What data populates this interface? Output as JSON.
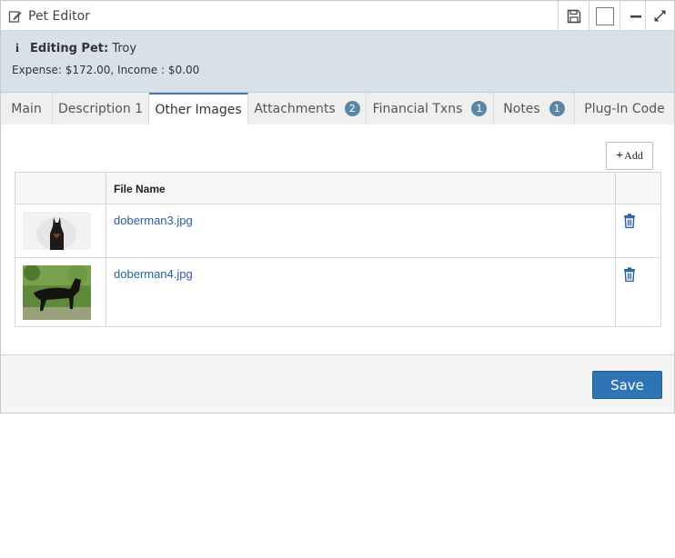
{
  "window": {
    "title": "Pet Editor"
  },
  "info": {
    "editing_label": "Editing Pet:",
    "pet_name": "Troy",
    "summary": "Expense: $172.00, Income : $0.00"
  },
  "tabs": [
    {
      "label": "Main",
      "badge": null,
      "active": false
    },
    {
      "label": "Description 1",
      "badge": null,
      "active": false
    },
    {
      "label": "Other Images",
      "badge": null,
      "active": true
    },
    {
      "label": "Attachments",
      "badge": "2",
      "active": false
    },
    {
      "label": "Financial Txns",
      "badge": "1",
      "active": false
    },
    {
      "label": "Notes",
      "badge": "1",
      "active": false
    },
    {
      "label": "Plug-In Code",
      "badge": null,
      "active": false
    }
  ],
  "toolbar": {
    "add_label": "Add"
  },
  "grid": {
    "columns": [
      "",
      "File Name",
      ""
    ],
    "rows": [
      {
        "file_name": "doberman3.jpg"
      },
      {
        "file_name": "doberman4.jpg"
      }
    ]
  },
  "footer": {
    "save_label": "Save"
  },
  "colors": {
    "accent": "#2f74b5",
    "badge": "#5a87a8",
    "info_bg": "#d8e0ea",
    "link": "#2a5f9e"
  },
  "icons": {
    "title": "edit-icon",
    "info": "info-icon",
    "delete": "trash-icon",
    "save_window": "floppy-disk-icon",
    "minimize": "minimize-icon",
    "expand": "expand-icon"
  }
}
